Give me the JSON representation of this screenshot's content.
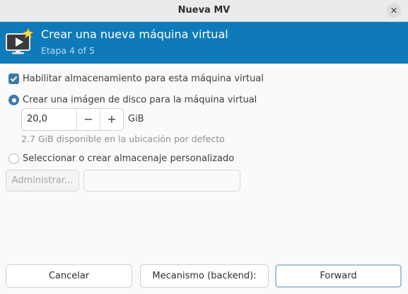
{
  "window": {
    "title": "Nueva MV",
    "close_glyph": "✕"
  },
  "banner": {
    "title": "Crear una nueva máquina virtual",
    "subtitle": "Etapa 4 of 5",
    "icon": "vm-monitor-star-icon",
    "background": "#0f7ab9"
  },
  "storage": {
    "enable_label": "Habilitar almacenamiento para esta máquina virtual",
    "enable_checked": true,
    "create_image_label": "Crear una imágen de disco para la máquina virtual",
    "create_image_selected": true,
    "size_value": "20,0",
    "decrement_glyph": "−",
    "increment_glyph": "+",
    "size_unit": "GiB",
    "available_hint": "2.7 GiB disponible en la ubicación por defecto",
    "custom_label": "Seleccionar o crear almacenaje personalizado",
    "custom_selected": false,
    "manage_label": "Administrar...",
    "path_value": ""
  },
  "footer": {
    "cancel_label": "Cancelar",
    "backend_label": "Mecanismo (backend):",
    "forward_label": "Forward"
  }
}
